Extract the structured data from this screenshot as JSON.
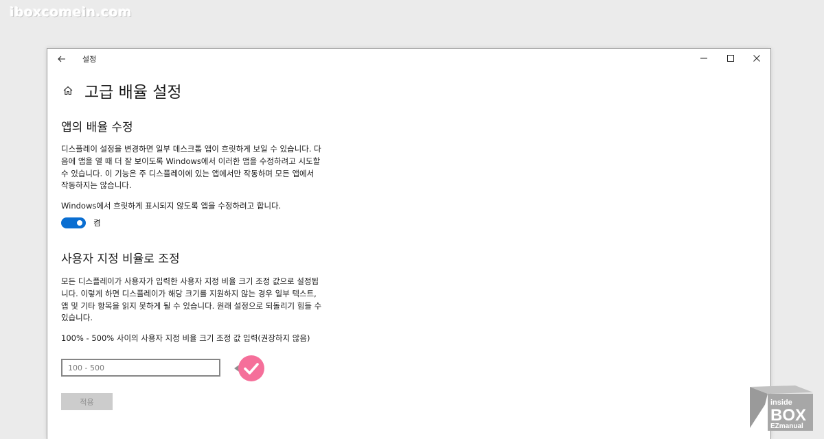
{
  "watermark_text": "iboxcomein.com",
  "window": {
    "title": "설정",
    "controls": {
      "minimize_icon": "minimize-icon",
      "maximize_icon": "maximize-icon",
      "close_icon": "close-icon"
    }
  },
  "page": {
    "title": "고급 배율 설정",
    "home_icon": "home-icon",
    "back_icon": "back-arrow-icon"
  },
  "fix_apps": {
    "title": "앱의 배율 수정",
    "description": "디스플레이 설정을 변경하면 일부 데스크톱 앱이 흐릿하게 보일 수 있습니다. 다음에 앱을 열 때 더 잘 보이도록 Windows에서 이러한 앱을 수정하려고 시도할 수 있습니다. 이 기능은 주 디스플레이에 있는 앱에서만 작동하며 모든 앱에서 작동하지는 않습니다.",
    "toggle_label": "Windows에서 흐릿하게 표시되지 않도록 앱을 수정하려고 합니다.",
    "toggle_state": "켬",
    "toggle_on": true
  },
  "custom_scaling": {
    "title": "사용자 지정 비율로 조정",
    "description": "모든 디스플레이가 사용자가 입력한 사용자 지정 비율 크기 조정 값으로 설정됩니다. 이렇게 하면 디스플레이가 해당 크기를 지원하지 않는 경우 일부 텍스트, 앱 및 기타 항목을 읽지 못하게 될 수 있습니다. 원래 설정으로 되돌리기 힘들 수 있습니다.",
    "input_label": "100% - 500% 사이의 사용자 지정 비율 크기 조정 값 입력(권장하지 않음)",
    "input_placeholder": "100 - 500",
    "input_value": "",
    "apply_label": "적용"
  },
  "annotation": {
    "marker_icon": "checkmark-pointer-icon",
    "marker_color": "#f56f9a"
  },
  "logo": {
    "line1": "inside",
    "line2": "BOX",
    "line3": "EZmanual"
  },
  "colors": {
    "accent": "#0a6ed1",
    "background": "#ebebeb",
    "window": "#ffffff",
    "apply_button_disabled": "#cccccc"
  }
}
